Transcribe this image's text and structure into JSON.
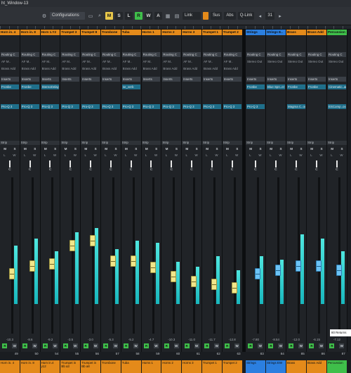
{
  "window": {
    "title": "ht_Window-13"
  },
  "toolbar": {
    "configurations": "Configurations",
    "m": "M",
    "s": "S",
    "l": "L",
    "r": "R",
    "w": "W",
    "a": "A",
    "link": "Link",
    "sus": "Sus",
    "abs": "Abs",
    "qlink": "Q-Link",
    "page": "31"
  },
  "channels": [
    {
      "name": "Horn in. 4",
      "color": "#e48a1a",
      "routing": "Routing C",
      "out": "AF M..",
      "send": "Brass Add",
      "insert": "Fronbe",
      "plug": "Pro-Q 3",
      "vol": "-10.3",
      "num": "49",
      "bottom": "Horn in. 4",
      "meter": 0.55,
      "fader": 0.42,
      "blue": false
    },
    {
      "name": "Horn in. 8",
      "color": "#e48a1a",
      "routing": "Routing C",
      "out": "AF M..",
      "send": "Brass Add",
      "insert": "Fronbe",
      "plug": "Pro-Q 3",
      "vol": "-8.6",
      "num": "50",
      "bottom": "Horn in. 8",
      "meter": 0.62,
      "fader": 0.47,
      "blue": false
    },
    {
      "name": "Horn 1.Y2",
      "color": "#e48a1a",
      "routing": "Routing C",
      "out": "AF M..",
      "send": "Brass Add",
      "insert": "StereoDelay",
      "plug": "Pro-Q 3",
      "vol": "-9.2",
      "num": "54",
      "bottom": "Horn in.4 y12",
      "meter": 0.5,
      "fader": 0.48,
      "blue": false
    },
    {
      "name": "Trumpet 3",
      "color": "#e48a1a",
      "routing": "Routing C",
      "out": "AF M..",
      "send": "Brass Add",
      "insert": "",
      "plug": "Pro-Q 3",
      "vol": "-3.5",
      "num": "55",
      "bottom": "Trumpet in Bb a3",
      "meter": 0.68,
      "fader": 0.6,
      "blue": false
    },
    {
      "name": "Trumpet 8",
      "color": "#e48a1a",
      "routing": "Routing C",
      "out": "AF M..",
      "send": "Brass Add",
      "insert": "",
      "plug": "Pro-Q 3",
      "vol": "-3.0",
      "num": "56",
      "bottom": "Trumpet in Bb a8",
      "meter": 0.72,
      "fader": 0.63,
      "blue": false
    },
    {
      "name": "Trombone",
      "color": "#e48a1a",
      "routing": "Routing C",
      "out": "AF M..",
      "send": "Brass Add",
      "insert": "",
      "plug": "Pro-Q 3",
      "vol": "-5.3",
      "num": "57",
      "bottom": "Trombone",
      "meter": 0.52,
      "fader": 0.5,
      "blue": false
    },
    {
      "name": "Tuba",
      "color": "#e48a1a",
      "routing": "Routing C",
      "out": "AF M..",
      "send": "Brass Add",
      "insert": "se_verb",
      "plug": "Pro-Q 3",
      "vol": "-5.2",
      "num": "58",
      "bottom": "Tuba",
      "meter": 0.6,
      "fader": 0.5,
      "blue": false
    },
    {
      "name": "Horns 1",
      "color": "#e48a1a",
      "routing": "Routing C",
      "out": "AF M..",
      "send": "Brass Add",
      "insert": "",
      "plug": "Pro-Q 3",
      "vol": "-4.7",
      "num": "59",
      "bottom": "Horns 1",
      "meter": 0.58,
      "fader": 0.46,
      "blue": false
    },
    {
      "name": "Horns 2",
      "color": "#e48a1a",
      "routing": "Routing C",
      "out": "AF M..",
      "send": "Brass Add",
      "insert": "",
      "plug": "Pro-Q 3",
      "vol": "-10.3",
      "num": "60",
      "bottom": "Horns 2",
      "meter": 0.4,
      "fader": 0.4,
      "blue": false
    },
    {
      "name": "Horns 3",
      "color": "#e48a1a",
      "routing": "Routing C",
      "out": "AF M..",
      "send": "Brass Add",
      "insert": "",
      "plug": "Pro-Q 3",
      "vol": "-11.0",
      "num": "61",
      "bottom": "Horns 3",
      "meter": 0.35,
      "fader": 0.37,
      "blue": false
    },
    {
      "name": "Trumpet 1",
      "color": "#e48a1a",
      "routing": "Routing C",
      "out": "AF M..",
      "send": "Brass Add",
      "insert": "",
      "plug": "Pro-Q 3",
      "vol": "-11.7",
      "num": "62",
      "bottom": "Trumpet 1",
      "meter": 0.45,
      "fader": 0.35,
      "blue": false
    },
    {
      "name": "Trumpet 2",
      "color": "#e48a1a",
      "routing": "Routing C",
      "out": "AF M..",
      "send": "Brass Add",
      "insert": "",
      "plug": "Pro-Q 3",
      "vol": "-12.8",
      "num": "63",
      "bottom": "Trumpet 2",
      "meter": 0.32,
      "fader": 0.33,
      "blue": false
    },
    {
      "name": "Strings",
      "color": "#2b7fe0",
      "routing": "Routing C",
      "out": "Stereo Out",
      "send": "",
      "insert": "Fronbe",
      "plug": "Pro-Q 3",
      "vol": "-7.80",
      "num": "83",
      "bottom": "Strings",
      "meter": 0.45,
      "fader": 0.42,
      "blue": true
    },
    {
      "name": "Strings E..",
      "color": "#2b7fe0",
      "routing": "Routing C",
      "out": "Stereo Out",
      "send": "",
      "insert": "Blue Spn..er",
      "plug": "",
      "vol": "-8.54",
      "num": "84",
      "bottom": "Strings EW",
      "meter": 0.42,
      "fader": 0.44,
      "blue": true
    },
    {
      "name": "Brass",
      "color": "#e48a1a",
      "routing": "Routing C",
      "out": "Stereo Out",
      "send": "",
      "insert": "Fronbe",
      "plug": "Magma C..ou",
      "vol": "-12.0",
      "num": "85",
      "bottom": "Brass",
      "meter": 0.66,
      "fader": 0.47,
      "blue": true
    },
    {
      "name": "Brass Add",
      "color": "#e48a1a",
      "routing": "Routing C",
      "out": "Stereo Out",
      "send": "",
      "insert": "Fronbe",
      "plug": "",
      "vol": "-6.15",
      "num": "86",
      "bottom": "Brass Add",
      "meter": 0.62,
      "fader": 0.47,
      "blue": true
    },
    {
      "name": "Percussion",
      "color": "#3fbf4a",
      "routing": "Routing C",
      "out": "Stereo Out",
      "send": "",
      "insert": "Cinematic..ar",
      "plug": "ESComp..ox",
      "vol": "-7.12",
      "num": "87",
      "bottom": "Percussion",
      "meter": 0.5,
      "fader": 0.44,
      "blue": true
    }
  ],
  "labels": {
    "insert_hdr": "Inserts",
    "strip_hdr": "Strip",
    "mute": "M",
    "solo": "S",
    "listen": "L",
    "write_lw": "W",
    "read": "R",
    "write": "W",
    "knob_lbl": "C",
    "knob_lbl_alt": "L11"
  },
  "status": "80 Returns"
}
